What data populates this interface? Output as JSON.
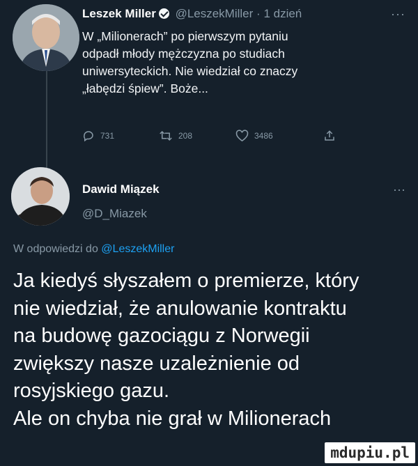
{
  "tweet1": {
    "author_name": "Leszek Miller",
    "handle": "@LeszekMiller",
    "separator": "·",
    "time": "1 dzień",
    "more": "···",
    "text_lines": [
      "W „Milionerach” po pierwszym pytaniu",
      "odpadł młody mężczyzna po studiach",
      "uniwersyteckich. Nie wiedział co znaczy",
      "„łabędzi śpiew”. Boże..."
    ],
    "reply_count": "731",
    "retweet_count": "208",
    "like_count": "3486"
  },
  "tweet2": {
    "author_name": "Dawid Miązek",
    "handle": "@D_Miazek",
    "more": "···",
    "reply_prefix": "W odpowiedzi do",
    "reply_target": "@LeszekMiller",
    "text_lines": [
      "Ja kiedyś słyszałem o premierze, który",
      "nie wiedział, że anulowanie kontraktu",
      "na budowę gazociągu z Norwegii",
      "zwiększy nasze uzależnienie od",
      "rosyjskiego gazu.",
      "Ale on chyba nie grał w Milionerach"
    ]
  },
  "watermark": "mdupiu.pl",
  "icons": [
    "reply-icon",
    "retweet-icon",
    "like-icon",
    "share-icon",
    "verified-badge-icon"
  ],
  "colors": {
    "background": "#15202b",
    "muted": "#8899a6",
    "link": "#1da1f2"
  }
}
